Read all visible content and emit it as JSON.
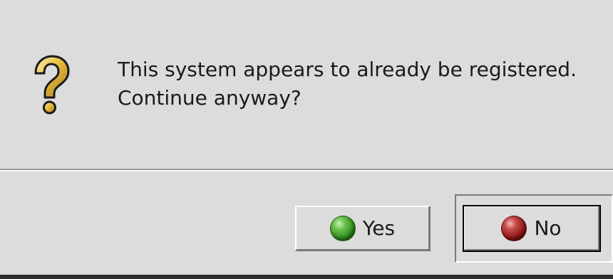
{
  "dialog": {
    "icon": "question-icon",
    "message_line1": "This system appears to already be registered.",
    "message_line2": "Continue anyway?"
  },
  "buttons": {
    "yes_label": "Yes",
    "yes_icon": "green-orb-icon",
    "no_label": "No",
    "no_icon": "red-orb-icon",
    "default": "No"
  },
  "colors": {
    "background": "#dcdcdc",
    "question_mark": "#e0b840",
    "yes_orb": "#2d8a1c",
    "no_orb": "#8c1313"
  }
}
